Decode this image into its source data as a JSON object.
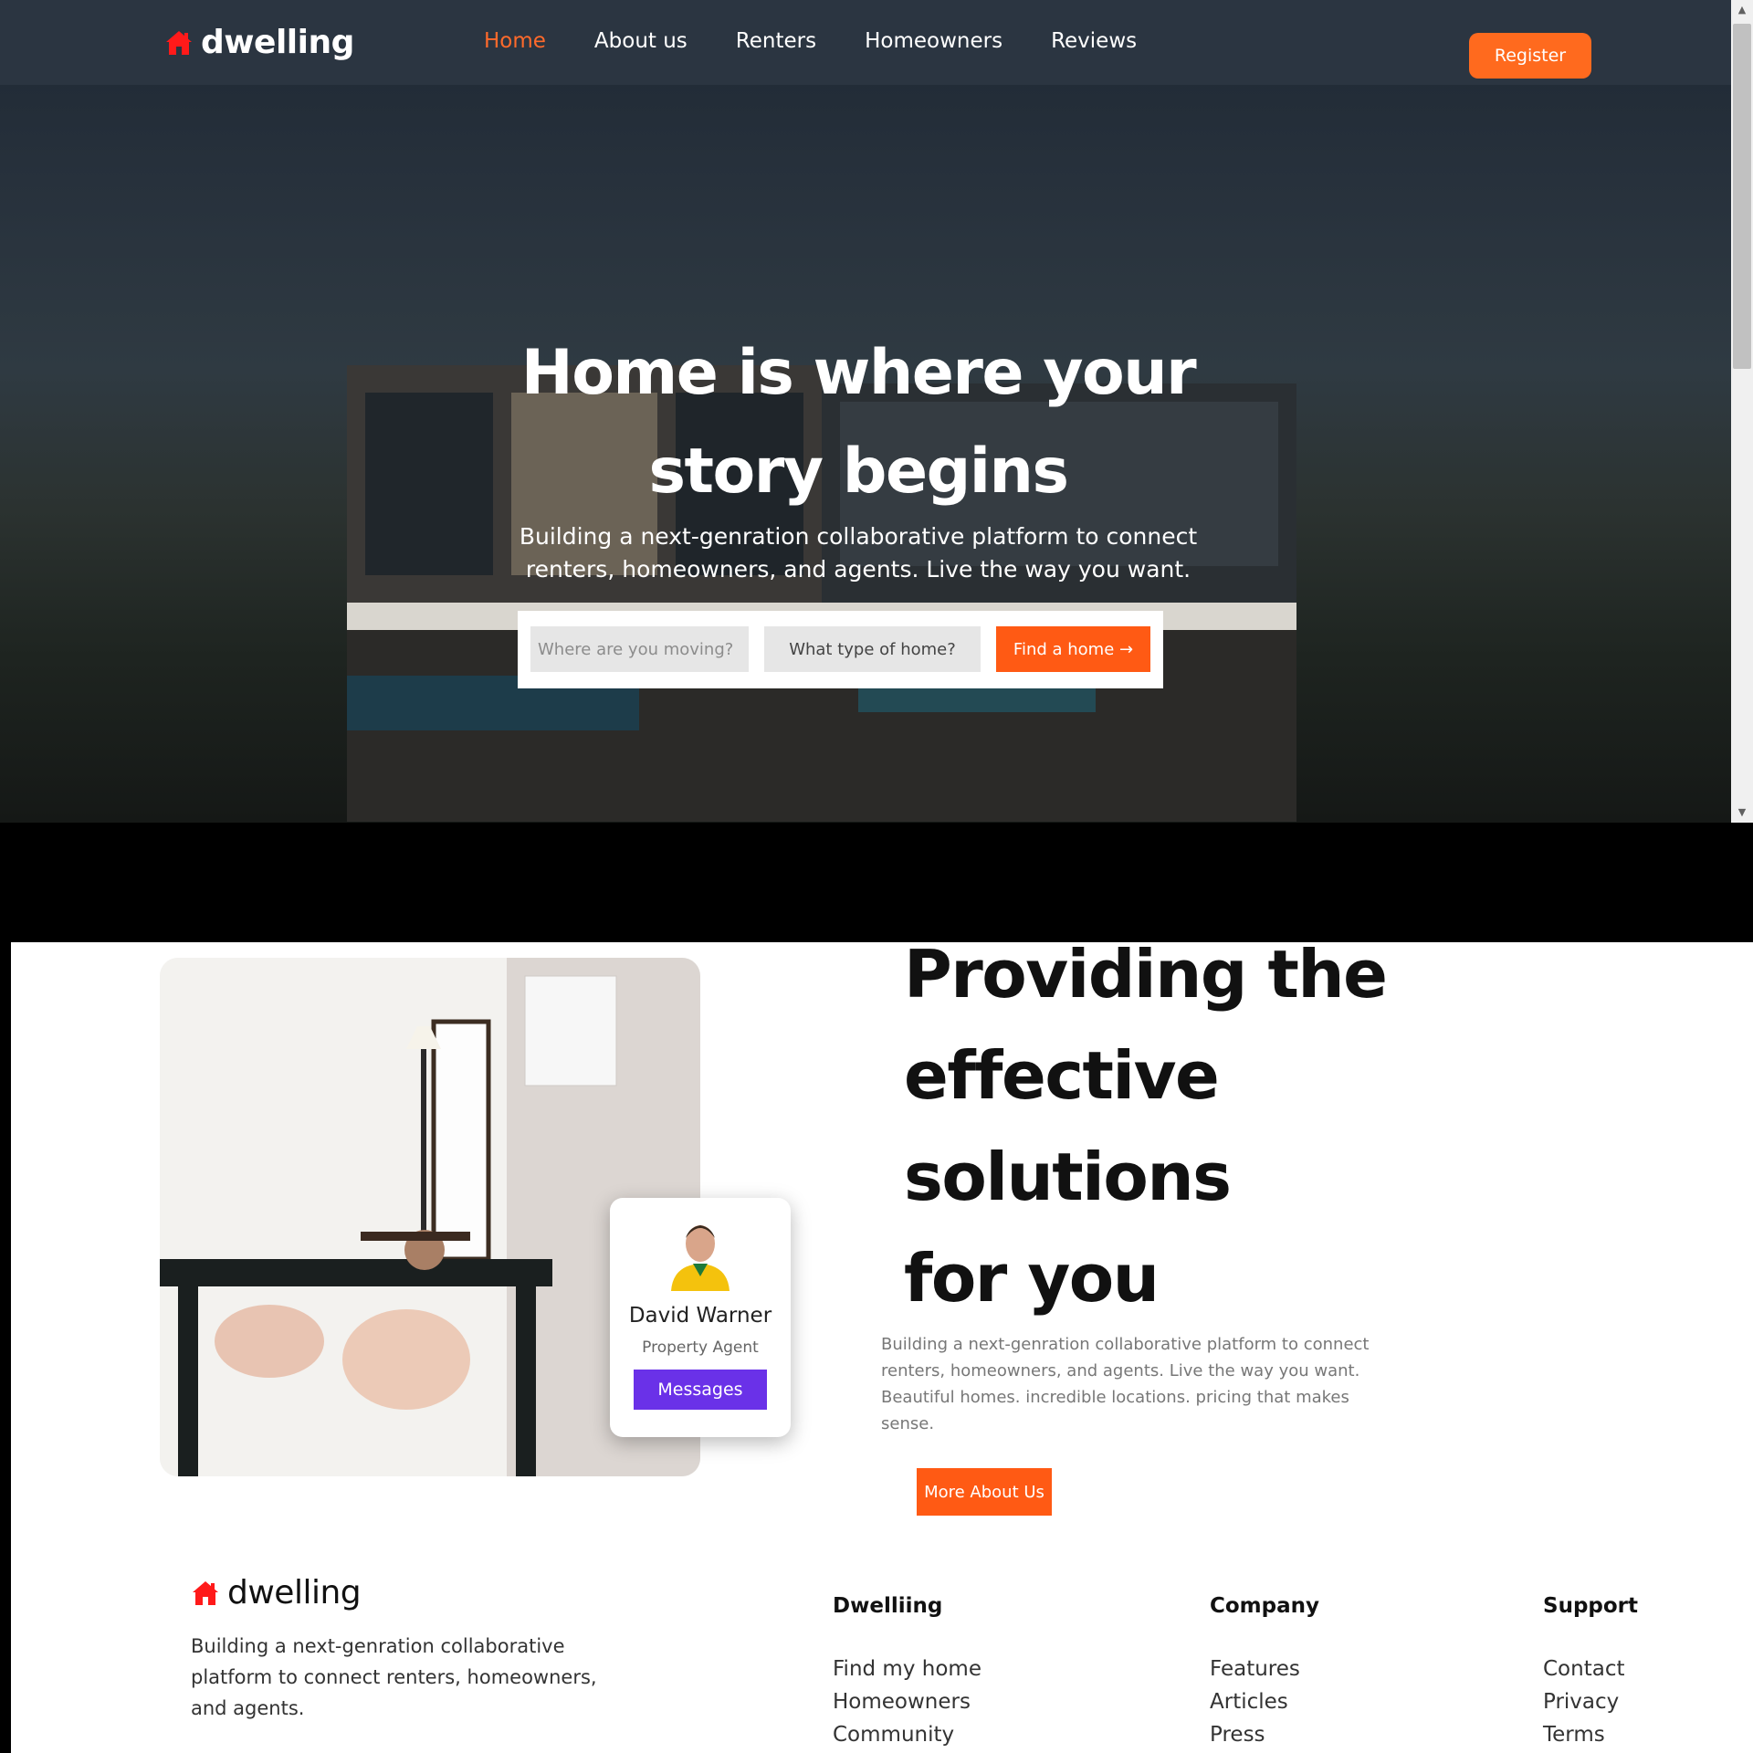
{
  "brand": {
    "name": "dwelling",
    "accent": "#ff6a1e",
    "logo_color": "#ff1a1a"
  },
  "nav": {
    "items": [
      {
        "label": "Home",
        "active": true
      },
      {
        "label": "About us"
      },
      {
        "label": "Renters"
      },
      {
        "label": "Homeowners"
      },
      {
        "label": "Reviews"
      }
    ],
    "register_label": "Register"
  },
  "hero": {
    "title_line1": "Home is where your",
    "title_line2": "story begins",
    "subtitle": "Building a next-genration collaborative platform to connect renters, homeowners, and agents. Live the way you want.",
    "search": {
      "location_placeholder": "Where are you moving?",
      "type_placeholder": "What type of home?",
      "button_label": "Find a home →"
    }
  },
  "about": {
    "title_lines": [
      "Providing the",
      "effective",
      "solutions",
      "for you"
    ],
    "description": "Building a next-genration collaborative platform to connect renters, homeowners, and agents. Live the way you want. Beautiful homes. incredible locations. pricing that makes sense.",
    "button_label": "More About Us",
    "agent": {
      "name": "David Warner",
      "role": "Property Agent",
      "button_label": "Messages",
      "button_color": "#6a31e8"
    }
  },
  "footer": {
    "brand": "dwelling",
    "description": "Building a next-genration collaborative platform to connect renters, homeowners, and agents.",
    "columns": [
      {
        "heading": "Dwelliing",
        "links": [
          "Find my home",
          "Homeowners",
          "Community"
        ]
      },
      {
        "heading": "Company",
        "links": [
          "Features",
          "Articles",
          "Press"
        ]
      },
      {
        "heading": "Support",
        "links": [
          "Contact",
          "Privacy",
          "Terms"
        ]
      }
    ]
  }
}
